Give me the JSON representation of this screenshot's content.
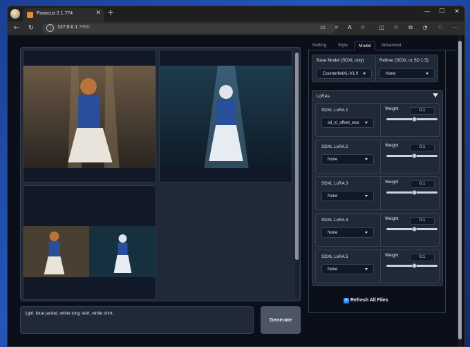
{
  "browser": {
    "tab_title": "Fooocus 2.1.774",
    "url_host": "127.0.0.1",
    "url_port": ":7860",
    "accent": "#e8893a"
  },
  "gallery": {
    "images": [
      "anime-girl-cathedral-1",
      "anime-girl-cathedral-2",
      "anime-girl-grid"
    ]
  },
  "prompt": {
    "value": "1girl, blue jacket, white long skirt, white shirt,"
  },
  "generate_label": "Generate",
  "tabs": [
    "Setting",
    "Style",
    "Model",
    "Advanced"
  ],
  "active_tab": "Model",
  "model": {
    "base_label": "Base Model (SDXL only)",
    "base_value": "CounterfeitXL-V1.0",
    "refiner_label": "Refiner (SDXL or SD 1.5)",
    "refiner_value": "None"
  },
  "loras_header": "LoRAs",
  "loras": [
    {
      "label": "SDXL LoRA 1",
      "value": "sd_xl_offset_exa",
      "weight_label": "Weight",
      "weight": "0.1",
      "slider": 0.55
    },
    {
      "label": "SDXL LoRA 2",
      "value": "None",
      "weight_label": "Weight",
      "weight": "0.1",
      "slider": 0.55
    },
    {
      "label": "SDXL LoRA 3",
      "value": "None",
      "weight_label": "Weight",
      "weight": "0.1",
      "slider": 0.55
    },
    {
      "label": "SDXL LoRA 4",
      "value": "None",
      "weight_label": "Weight",
      "weight": "0.1",
      "slider": 0.55
    },
    {
      "label": "SDXL LoRA 5",
      "value": "None",
      "weight_label": "Weight",
      "weight": "0.1",
      "slider": 0.55
    }
  ],
  "refresh_label": "Refresh All Files"
}
